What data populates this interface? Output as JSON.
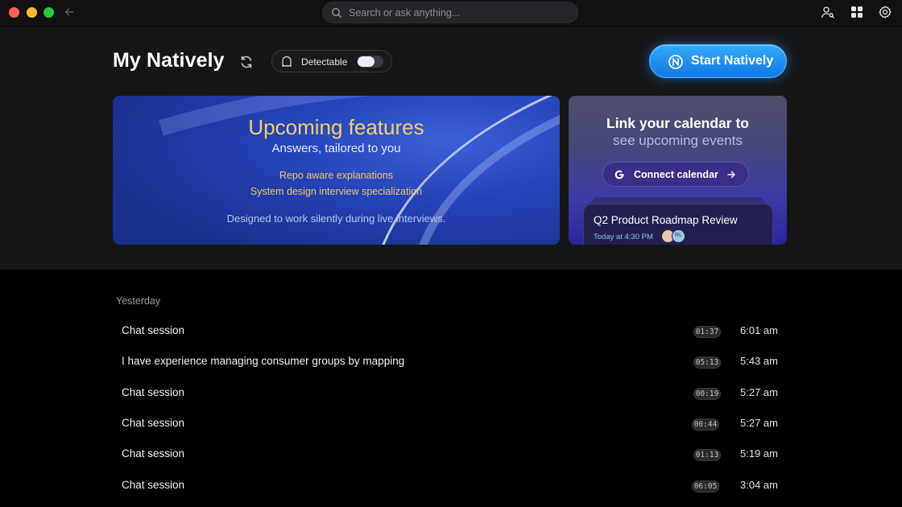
{
  "search": {
    "placeholder": "Search or ask anything..."
  },
  "header": {
    "title": "My Natively",
    "detect_label": "Detectable",
    "start_button": "Start Natively"
  },
  "feature": {
    "title": "Upcoming features",
    "subtitle": "Answers, tailored to you",
    "items": [
      "Repo aware explanations",
      "System design interview specialization"
    ],
    "footer": "Designed to work silently during live interviews."
  },
  "calendar": {
    "title_line1": "Link your calendar to",
    "title_line2": "see upcoming events",
    "connect_button": "Connect calendar",
    "event_title": "Q2 Product Roadmap Review",
    "event_time": "Today at 4:30 PM",
    "avatar2_initials": "RL"
  },
  "sessions": {
    "group": "Yesterday",
    "rows": [
      {
        "title": "Chat session",
        "duration": "01:37",
        "time": "6:01 am"
      },
      {
        "title": "I have experience managing consumer groups by mapping",
        "duration": "05:13",
        "time": "5:43 am"
      },
      {
        "title": "Chat session",
        "duration": "00:19",
        "time": "5:27 am"
      },
      {
        "title": "Chat session",
        "duration": "00:44",
        "time": "5:27 am"
      },
      {
        "title": "Chat session",
        "duration": "01:13",
        "time": "5:19 am"
      },
      {
        "title": "Chat session",
        "duration": "06:05",
        "time": "3:04 am"
      }
    ]
  },
  "icons": {
    "back": "arrow-left-icon",
    "search": "search-icon",
    "profile": "user-search-icon",
    "grid": "grid-icon",
    "settings": "gear-icon",
    "refresh": "refresh-icon",
    "ghost": "ghost-icon",
    "natively": "natively-logo-icon",
    "google": "google-icon",
    "arrow": "arrow-right-icon"
  },
  "colors": {
    "accent_blue": "#1e8cf0",
    "feature_gold": "#f4cd74",
    "background": "#000000",
    "panel": "#161617"
  }
}
